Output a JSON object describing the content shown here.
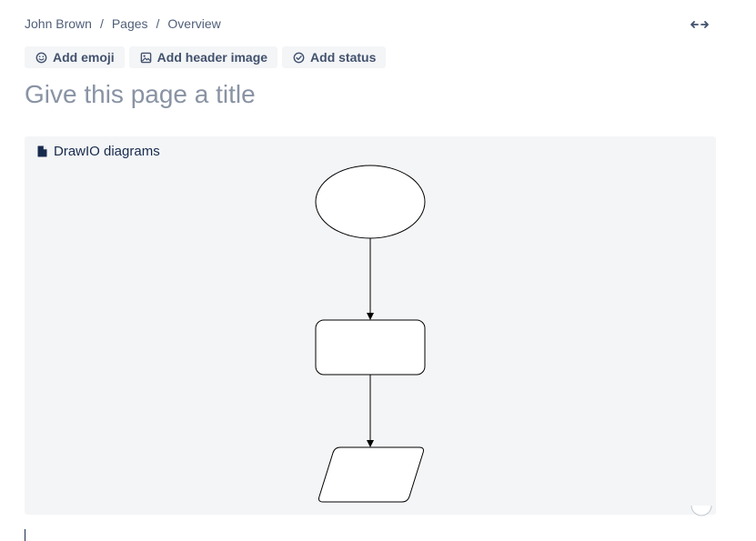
{
  "breadcrumb": {
    "items": [
      "John Brown",
      "Pages",
      "Overview"
    ],
    "separator": "/"
  },
  "header": {
    "expand_icon": "expand-horizontal-icon"
  },
  "toolbar": {
    "add_emoji": "Add emoji",
    "add_header_image": "Add header image",
    "add_status": "Add status"
  },
  "title": {
    "value": "",
    "placeholder": "Give this page a title"
  },
  "macro": {
    "icon": "document-icon",
    "label": "DrawIO diagrams",
    "diagram": {
      "nodes": [
        {
          "shape": "ellipse",
          "label": ""
        },
        {
          "shape": "rounded-rectangle",
          "label": ""
        },
        {
          "shape": "parallelogram",
          "label": ""
        }
      ]
    }
  },
  "colors": {
    "text": "#172b4d",
    "subtle_text": "#505f79",
    "button_bg": "#f4f5f7",
    "placeholder": "#8993a4",
    "macro_bg": "#f4f5f7"
  }
}
